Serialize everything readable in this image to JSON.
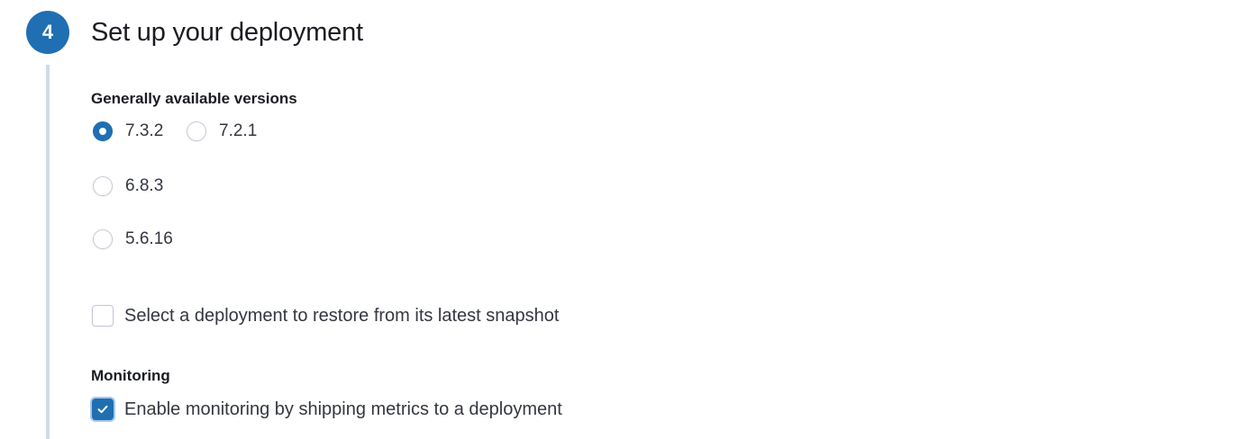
{
  "step": {
    "number": "4",
    "title": "Set up your deployment"
  },
  "versions": {
    "label": "Generally available versions",
    "options": [
      {
        "label": "7.3.2",
        "checked": true
      },
      {
        "label": "7.2.1",
        "checked": false
      },
      {
        "label": "6.8.3",
        "checked": false
      },
      {
        "label": "5.6.16",
        "checked": false
      }
    ],
    "selected": "7.3.2"
  },
  "restore": {
    "label": "Select a deployment to restore from its latest snapshot",
    "checked": false
  },
  "monitoring": {
    "heading": "Monitoring",
    "label": "Enable monitoring by shipping metrics to a deployment",
    "checked": true
  },
  "colors": {
    "accent": "#1f6fb2",
    "step_line": "#d3dae6"
  },
  "icons": {
    "check": "check-icon"
  }
}
